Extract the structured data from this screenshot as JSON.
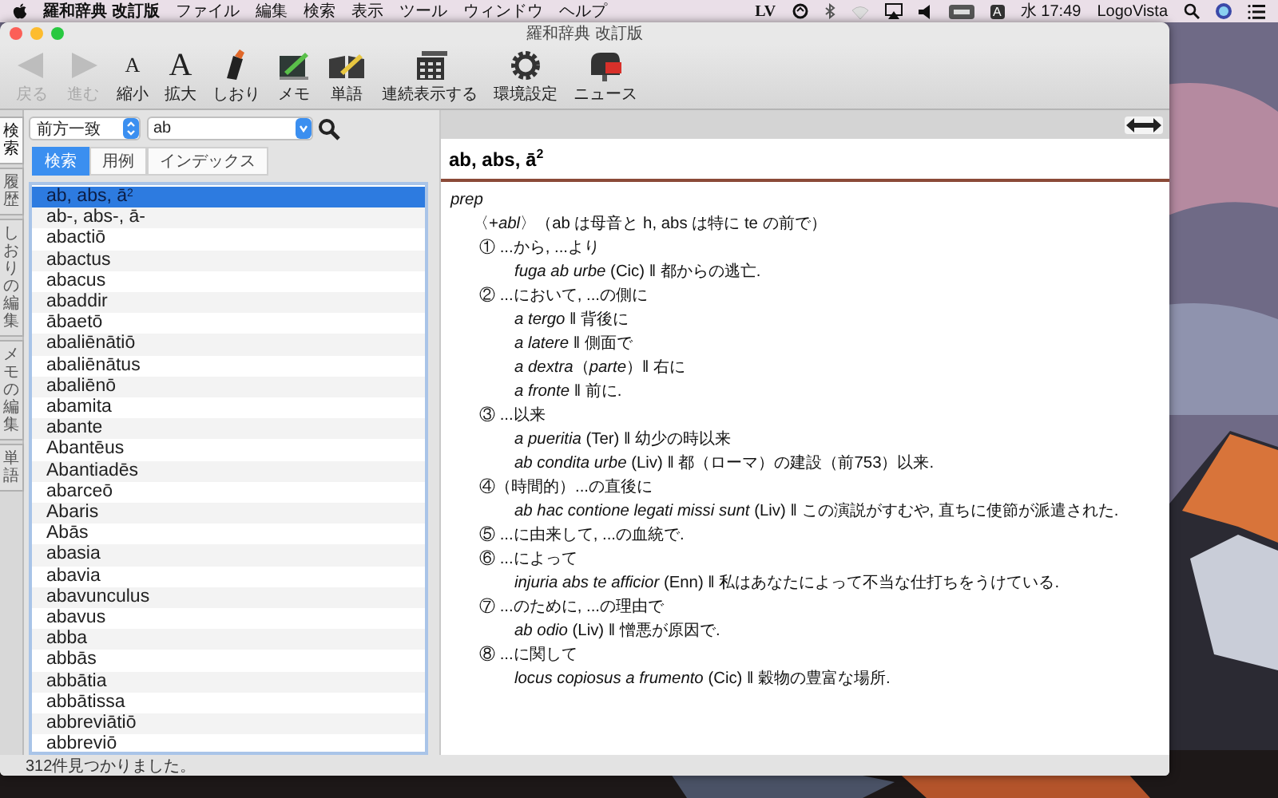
{
  "menubar": {
    "app_name": "羅和辞典 改訂版",
    "menus": [
      "ファイル",
      "編集",
      "検索",
      "表示",
      "ツール",
      "ウィンドウ",
      "ヘルプ"
    ],
    "logo": "LV",
    "input_source": "A",
    "clock": "水 17:49",
    "user": "LogoVista"
  },
  "window": {
    "title": "羅和辞典 改訂版"
  },
  "toolbar": [
    {
      "kind": "back",
      "label": "戻る",
      "disabled": true
    },
    {
      "kind": "forward",
      "label": "進む",
      "disabled": true
    },
    {
      "kind": "glyph_small",
      "glyph": "A",
      "label": "縮小",
      "disabled": false
    },
    {
      "kind": "glyph_large",
      "glyph": "A",
      "label": "拡大",
      "disabled": false
    },
    {
      "kind": "bookmark",
      "label": "しおり",
      "disabled": false
    },
    {
      "kind": "memo",
      "label": "メモ",
      "disabled": false
    },
    {
      "kind": "vocabulary",
      "label": "単語",
      "disabled": false
    },
    {
      "kind": "continuous",
      "label": "連続表示する",
      "disabled": false
    },
    {
      "kind": "settings",
      "label": "環境設定",
      "disabled": false
    },
    {
      "kind": "news",
      "label": "ニュース",
      "disabled": false
    }
  ],
  "side_tabs": [
    {
      "label": "検索",
      "selected": true
    },
    {
      "label": "履歴",
      "selected": false
    },
    {
      "label": "しおりの編集",
      "selected": false
    },
    {
      "label": "メモの編集",
      "selected": false
    },
    {
      "label": "単語",
      "selected": false
    }
  ],
  "search": {
    "mode": "前方一致",
    "query": "ab"
  },
  "search_tabs": [
    {
      "label": "検索",
      "selected": true
    },
    {
      "label": "用例",
      "selected": false
    },
    {
      "label": "インデックス",
      "selected": false
    }
  ],
  "results": [
    {
      "text": "ab, abs, ā$^{2}$",
      "selected": true
    },
    {
      "text": "ab-, abs-, ā-",
      "selected": false
    },
    {
      "text": "abactiō",
      "selected": false
    },
    {
      "text": "abactus",
      "selected": false
    },
    {
      "text": "abacus",
      "selected": false
    },
    {
      "text": "abaddir",
      "selected": false
    },
    {
      "text": "ābaetō",
      "selected": false
    },
    {
      "text": "abaliēnātiō",
      "selected": false
    },
    {
      "text": "abaliēnātus",
      "selected": false
    },
    {
      "text": "abaliēnō",
      "selected": false
    },
    {
      "text": "abamita",
      "selected": false
    },
    {
      "text": "abante",
      "selected": false
    },
    {
      "text": "Abantēus",
      "selected": false
    },
    {
      "text": "Abantiadēs",
      "selected": false
    },
    {
      "text": "abarceō",
      "selected": false
    },
    {
      "text": "Abaris",
      "selected": false
    },
    {
      "text": "Abās",
      "selected": false
    },
    {
      "text": "abasia",
      "selected": false
    },
    {
      "text": "abavia",
      "selected": false
    },
    {
      "text": "abavunculus",
      "selected": false
    },
    {
      "text": "abavus",
      "selected": false
    },
    {
      "text": "abba",
      "selected": false
    },
    {
      "text": "abbās",
      "selected": false
    },
    {
      "text": "abbātia",
      "selected": false
    },
    {
      "text": "abbātissa",
      "selected": false
    },
    {
      "text": "abbreviātiō",
      "selected": false
    },
    {
      "text": "abbreviō",
      "selected": false
    }
  ],
  "status_bar": "312件見つかりました。",
  "entry": {
    "headword": "ab, abs, ā$^{2}$",
    "pos": "prep",
    "usage": "〈+*abl*〉（ab は母音と h, abs は特に te の前で）",
    "senses": [
      {
        "text": "① ...から, ...より",
        "examples": [
          "*fuga ab urbe* (Cic) ‖ 都からの逃亡."
        ]
      },
      {
        "text": "② ...において, ...の側に",
        "examples": [
          "*a tergo* ‖ 背後に",
          "*a latere* ‖ 側面で",
          "*a dextra*（*parte*）‖ 右に",
          "*a fronte* ‖ 前に."
        ]
      },
      {
        "text": "③ ...以来",
        "examples": [
          "*a pueritia* (Ter) ‖ 幼少の時以来",
          "*ab condita urbe* (Liv) ‖ 都（ローマ）の建設（前753）以来."
        ]
      },
      {
        "text": "④（時間的）...の直後に",
        "examples": [
          "*ab hac contione legati missi sunt* (Liv) ‖ この演説がすむや, 直ちに使節が派遣された."
        ]
      },
      {
        "text": "⑤ ...に由来して, ...の血統で."
      },
      {
        "text": "⑥ ...によって",
        "examples": [
          "*injuria abs te afficior* (Enn) ‖ 私はあなたによって不当な仕打ちをうけている."
        ]
      },
      {
        "text": "⑦ ...のために, ...の理由で",
        "examples": [
          "*ab odio* (Liv) ‖ 憎悪が原因で."
        ]
      },
      {
        "text": "⑧ ...に関して",
        "examples": [
          "*locus copiosus a frumento* (Cic) ‖ 穀物の豊富な場所."
        ]
      }
    ]
  }
}
